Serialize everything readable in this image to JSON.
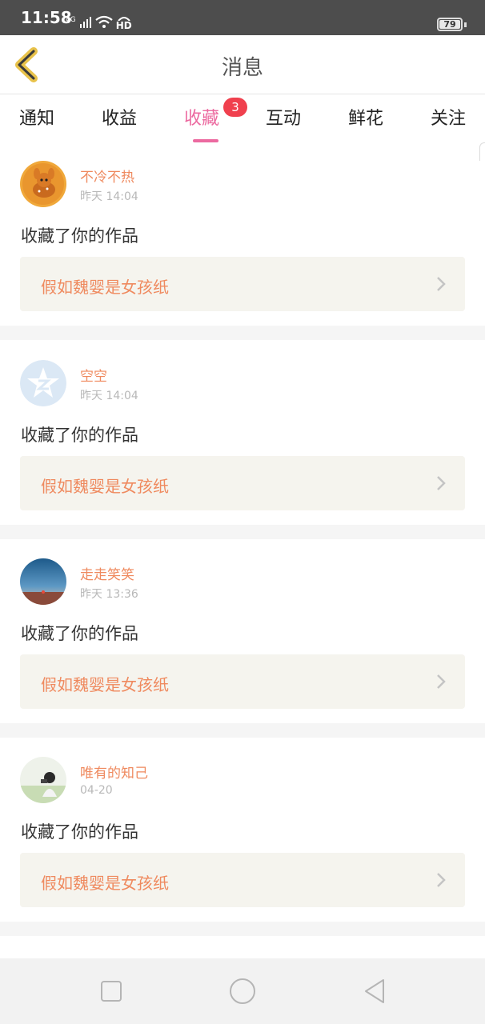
{
  "status_bar": {
    "time": "11:58",
    "network": "4G",
    "hd": "HD",
    "battery": "79"
  },
  "header": {
    "title": "消息",
    "back_icon": "chevron-left-icon"
  },
  "tabs": [
    {
      "label": "通知"
    },
    {
      "label": "收益"
    },
    {
      "label": "收藏",
      "active": true,
      "badge": "3"
    },
    {
      "label": "互动"
    },
    {
      "label": "鲜花"
    },
    {
      "label": "关注"
    }
  ],
  "items": [
    {
      "user": "不冷不热",
      "time": "昨天 14:04",
      "action": "收藏了你的作品",
      "work": "假如魏婴是女孩纸"
    },
    {
      "user": "空空",
      "time": "昨天 14:04",
      "action": "收藏了你的作品",
      "work": "假如魏婴是女孩纸"
    },
    {
      "user": "走走笑笑",
      "time": "昨天 13:36",
      "action": "收藏了你的作品",
      "work": "假如魏婴是女孩纸"
    },
    {
      "user": "唯有的知己",
      "time": "04-20",
      "action": "收藏了你的作品",
      "work": "假如魏婴是女孩纸"
    }
  ],
  "colors": {
    "accent_pink": "#ec6aa0",
    "accent_orange": "#ef8a5f",
    "badge_red": "#f0404e"
  },
  "nav": {
    "recent_icon": "square-icon",
    "home_icon": "circle-icon",
    "back_icon": "triangle-back-icon"
  }
}
